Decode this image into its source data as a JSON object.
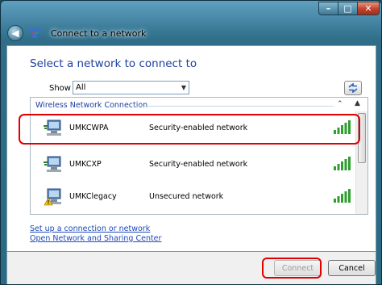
{
  "window": {
    "title": "Connect to a network",
    "caption_buttons": {
      "minimize": "–",
      "maximize": "□",
      "close": "✕"
    },
    "back_icon": "back-arrow-icon"
  },
  "main": {
    "heading": "Select a network to connect to",
    "show_label": "Show",
    "show_value": "All",
    "group_header": "Wireless Network Connection",
    "networks": [
      {
        "name": "UMKCWPA",
        "security": "Security-enabled network",
        "icon": "secured-network-icon",
        "signal_bars": 5
      },
      {
        "name": "UMKCXP",
        "security": "Security-enabled network",
        "icon": "secured-network-icon",
        "signal_bars": 5
      },
      {
        "name": "UMKClegacy",
        "security": "Unsecured network",
        "icon": "unsecured-network-icon",
        "signal_bars": 5
      }
    ],
    "links": {
      "setup": "Set up a connection or network",
      "center": "Open Network and Sharing Center"
    }
  },
  "footer": {
    "connect_label": "Connect",
    "cancel_label": "Cancel"
  },
  "colors": {
    "heading": "#1e3f9e",
    "link": "#1b48b8",
    "highlight": "#e00000",
    "signal": "#2e9e2e"
  }
}
